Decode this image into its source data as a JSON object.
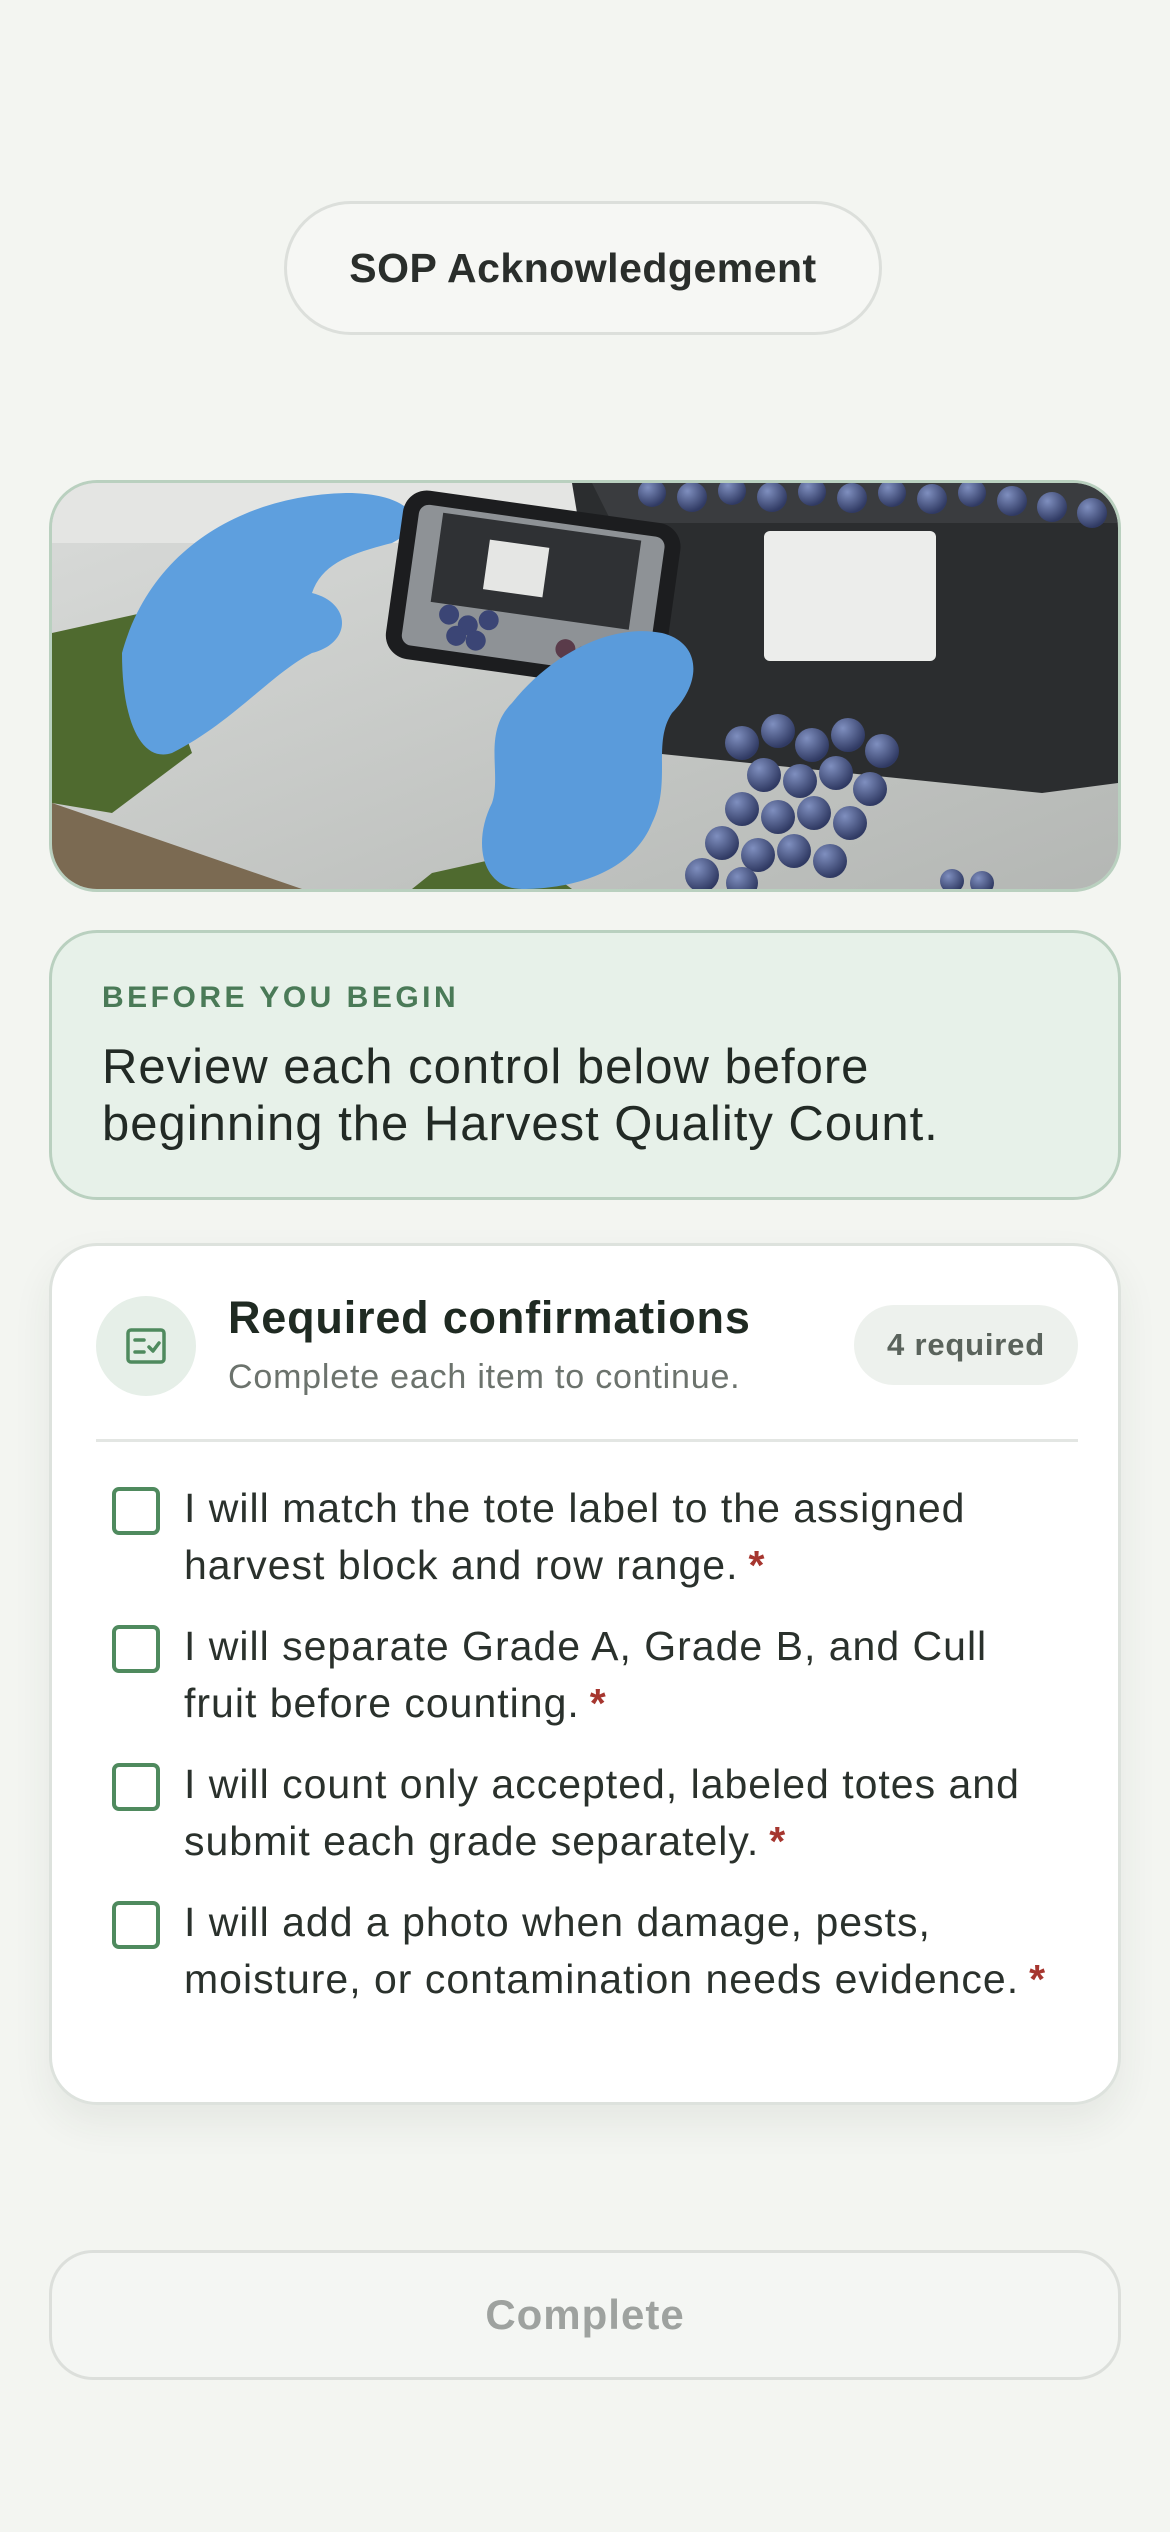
{
  "header": {
    "title": "SOP Acknowledgement"
  },
  "hero": {
    "image": "gloved-hands-photographing-blueberry-tote"
  },
  "intro": {
    "eyebrow": "BEFORE YOU BEGIN",
    "text": "Review each control below before beginning the Harvest Quality Count."
  },
  "confirmations": {
    "icon": "checklist-icon",
    "title": "Required confirmations",
    "subtitle": "Complete each item to continue.",
    "badge": "4 required",
    "required_marker": "*",
    "items": [
      {
        "label": "I will match the tote label to the assigned harvest block and row range.",
        "checked": false
      },
      {
        "label": "I will separate Grade A, Grade B, and Cull fruit before counting.",
        "checked": false
      },
      {
        "label": "I will count only accepted, labeled totes and submit each grade separately.",
        "checked": false
      },
      {
        "label": "I will add a photo when damage, pests, moisture, or contamination needs evidence.",
        "checked": false
      }
    ]
  },
  "footer": {
    "complete_label": "Complete",
    "enabled": false
  },
  "colors": {
    "background": "#f3f5f1",
    "accent": "#4f8a5e",
    "intro_bg": "#e7f1e9",
    "required": "#a6362f",
    "disabled_text": "#9ea29f"
  }
}
